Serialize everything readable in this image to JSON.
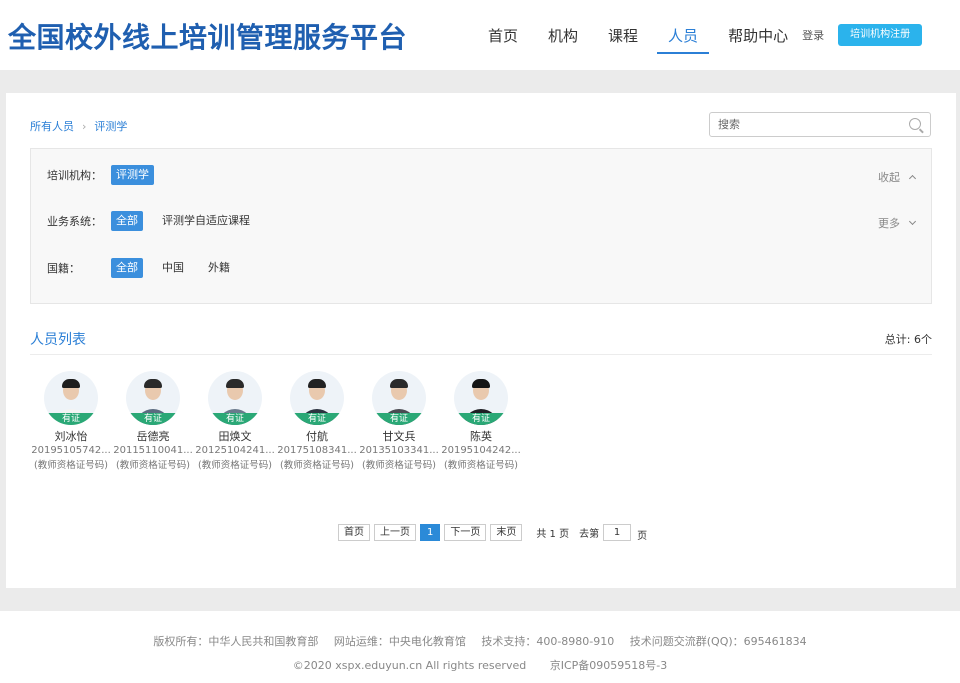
{
  "header": {
    "logo": "全国校外线上培训管理服务平台",
    "nav": [
      "首页",
      "机构",
      "课程",
      "人员",
      "帮助中心"
    ],
    "active_nav": "人员",
    "login": "登录",
    "register": "培训机构注册"
  },
  "breadcrumb": {
    "root": "所有人员",
    "current": "评测学"
  },
  "search": {
    "placeholder": "搜索"
  },
  "filters": {
    "org": {
      "label": "培训机构：",
      "tags": [
        "评测学"
      ],
      "toggle": "收起"
    },
    "system": {
      "label": "业务系统：",
      "tags": [
        "全部",
        "评测学自适应课程"
      ],
      "toggle": "更多"
    },
    "nationality": {
      "label": "国籍：",
      "tags": [
        "全部",
        "中国",
        "外籍"
      ]
    }
  },
  "list": {
    "title": "人员列表",
    "total": "总计: 6个",
    "badge": "有证",
    "note": "(教师资格证号码)",
    "people": [
      {
        "name": "刘冰怡",
        "id": "20195105742...",
        "shirt": "#f3f3f3",
        "hair": "#1e1e1e"
      },
      {
        "name": "岳德亮",
        "id": "20115110041...",
        "shirt": "#5b6b80",
        "hair": "#2a2a2a"
      },
      {
        "name": "田焕文",
        "id": "20125104241...",
        "shirt": "#6a7a8c",
        "hair": "#2a2a2a"
      },
      {
        "name": "付航",
        "id": "20175108341...",
        "shirt": "#2c3340",
        "hair": "#222222"
      },
      {
        "name": "甘文兵",
        "id": "20135103341...",
        "shirt": "#4a4a52",
        "hair": "#2a2a2a"
      },
      {
        "name": "陈英",
        "id": "20195104242...",
        "shirt": "#1f1f24",
        "hair": "#151515"
      }
    ]
  },
  "pager": {
    "first": "首页",
    "prev": "上一页",
    "current": "1",
    "next": "下一页",
    "last": "末页",
    "total_pages": "共 1 页",
    "goto": "去第",
    "goto_value": "1",
    "page_unit": "页"
  },
  "footer": {
    "line1": [
      "版权所有：中华人民共和国教育部",
      "网站运维：中央电化教育馆",
      "技术支持：400-8980-910",
      "技术问题交流群(QQ)：695461834"
    ],
    "line2": [
      "©2020 xspx.eduyun.cn All rights reserved",
      "京ICP备09059518号-3"
    ]
  },
  "colors": {
    "accent": "#2b7fd6",
    "register": "#2bb3ec",
    "badge": "#2aa876",
    "logo": "#1f5fb0"
  }
}
